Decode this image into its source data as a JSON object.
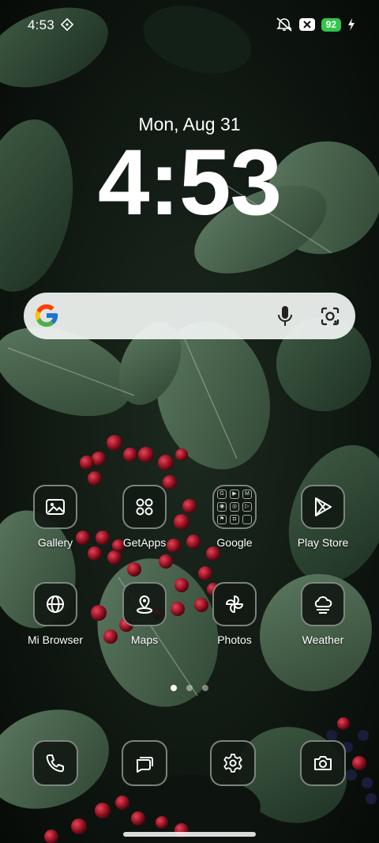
{
  "status_bar": {
    "time": "4:53",
    "battery_level": "92"
  },
  "lockscreen": {
    "date": "Mon, Aug 31",
    "clock": "4:53"
  },
  "search_bar": {
    "logo": "google-g-logo",
    "mic": "mic-icon",
    "lens": "camera-lens-icon"
  },
  "apps": [
    {
      "label": "Gallery",
      "icon": "gallery-icon"
    },
    {
      "label": "GetApps",
      "icon": "getapps-icon"
    },
    {
      "label": "Google",
      "icon": "folder-icon"
    },
    {
      "label": "Play Store",
      "icon": "play-store-icon"
    },
    {
      "label": "Mi Browser",
      "icon": "globe-icon"
    },
    {
      "label": "Maps",
      "icon": "map-pin-icon"
    },
    {
      "label": "Photos",
      "icon": "pinwheel-icon"
    },
    {
      "label": "Weather",
      "icon": "weather-cloud-icon"
    }
  ],
  "page_indicator": {
    "count": 3,
    "active_index": 0
  },
  "dock": [
    {
      "icon": "phone-icon"
    },
    {
      "icon": "messages-icon"
    },
    {
      "icon": "settings-gear-icon"
    },
    {
      "icon": "camera-icon"
    }
  ],
  "colors": {
    "battery": "#32c54a",
    "icon_bg": "#121a14",
    "search_bg": "#f0f4f2"
  }
}
